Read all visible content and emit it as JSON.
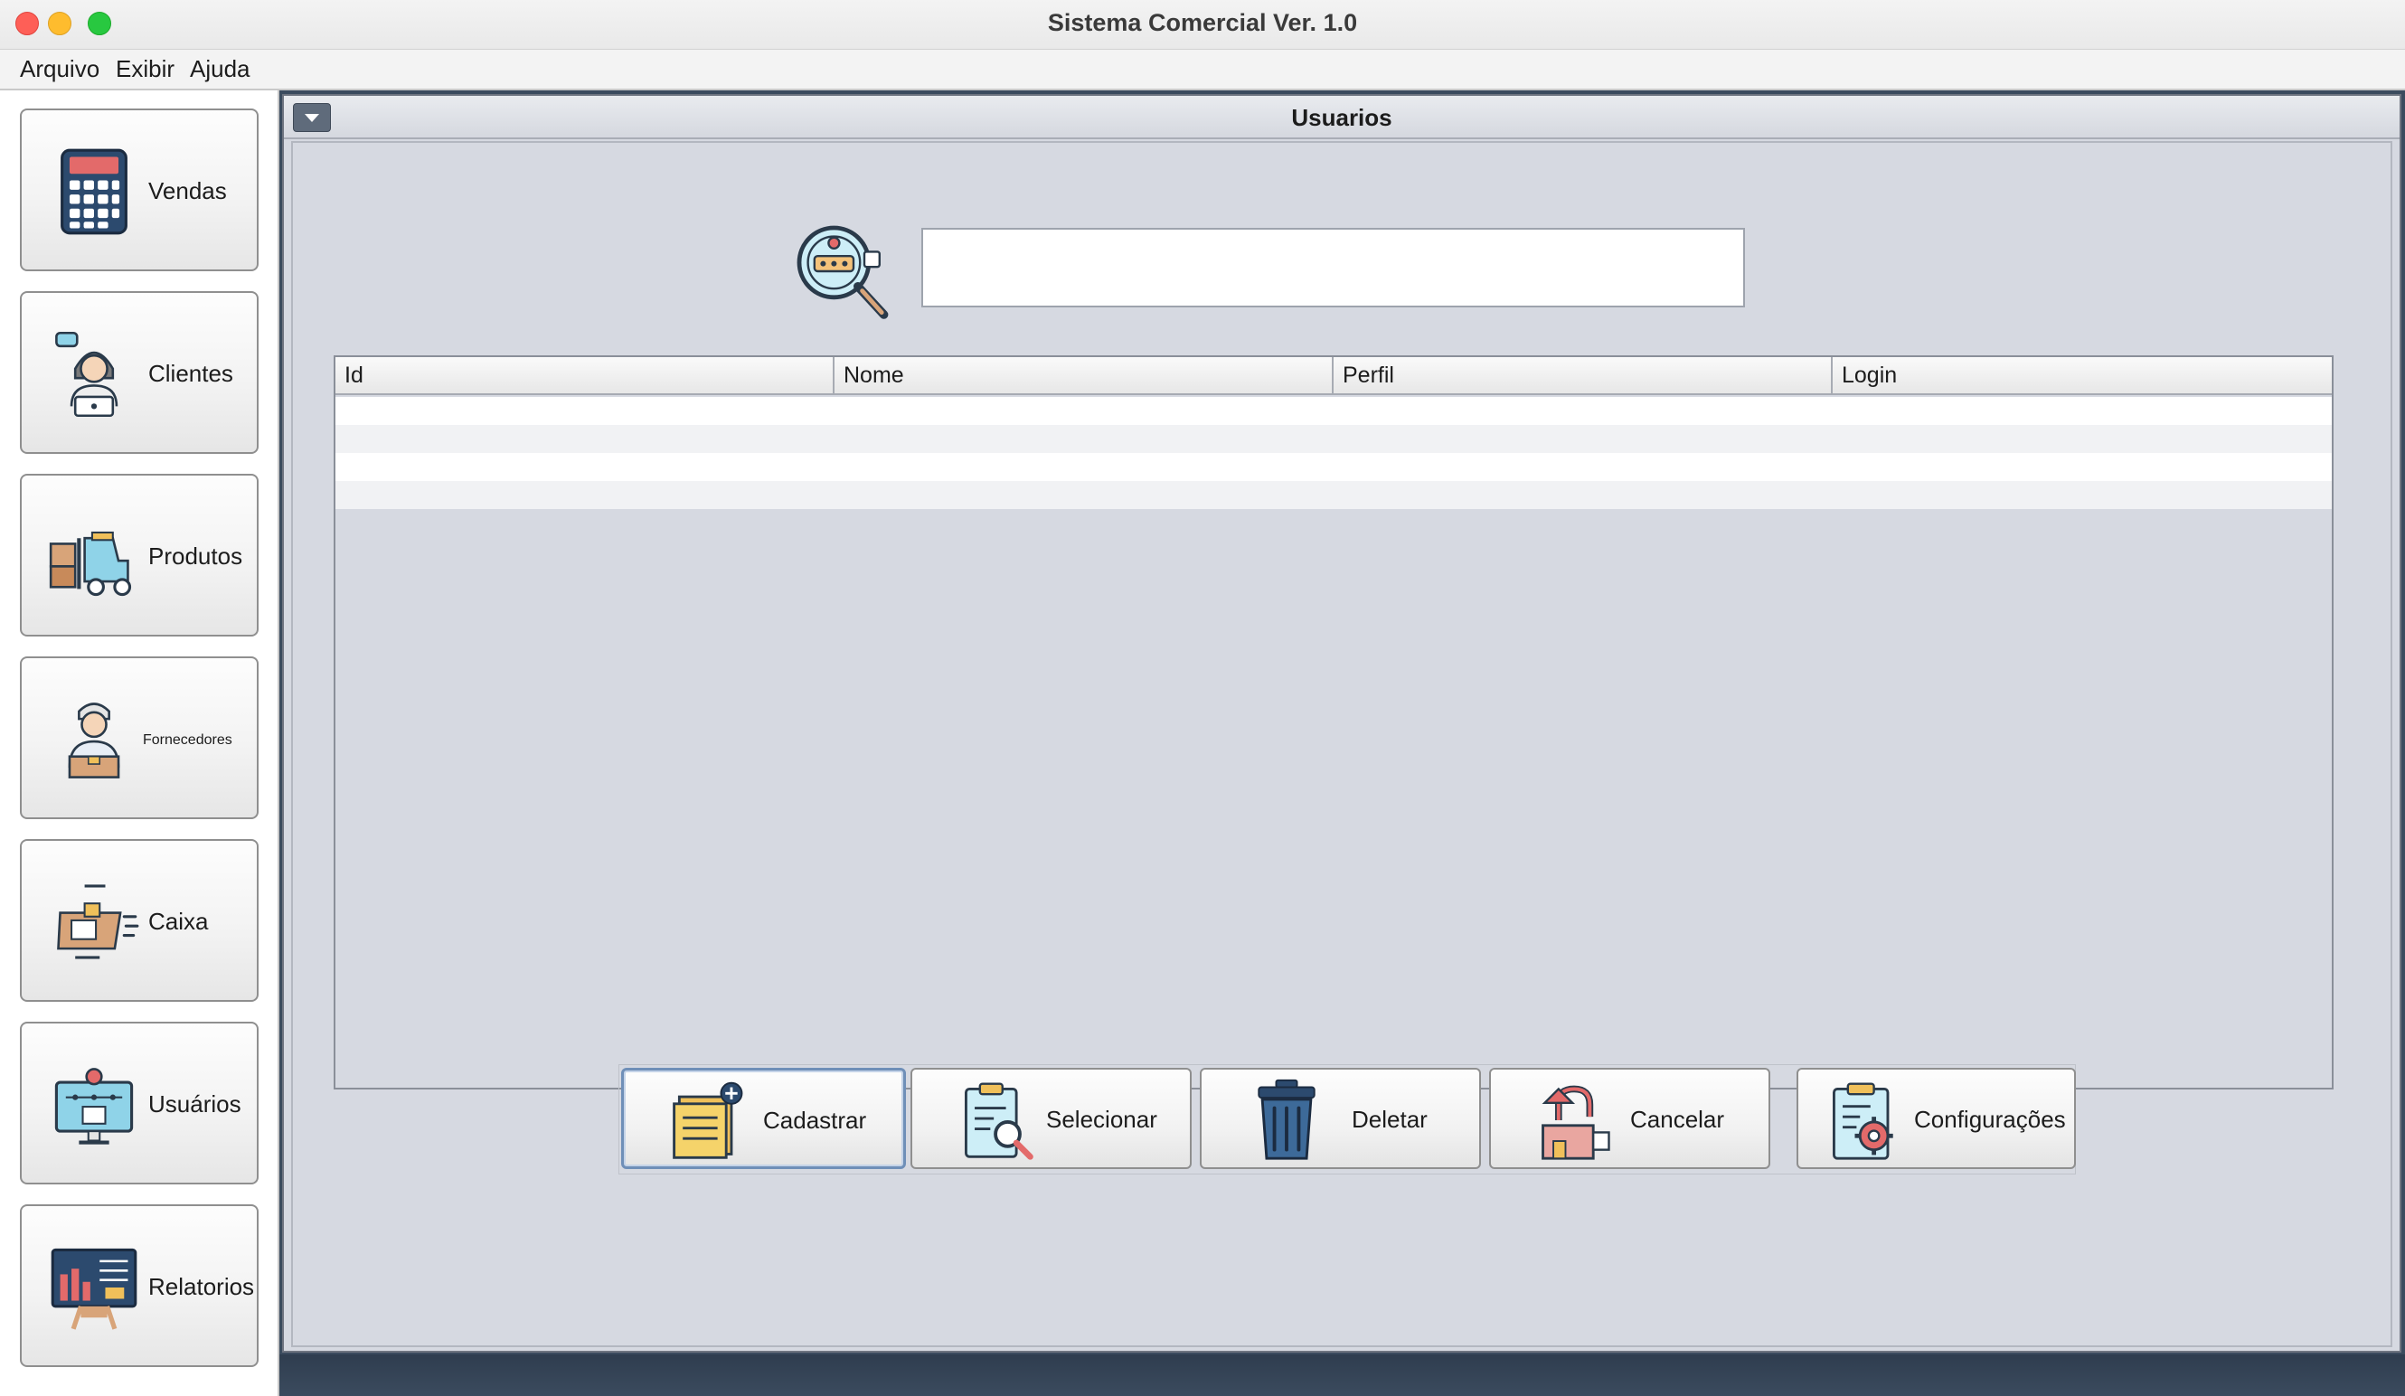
{
  "window": {
    "title": "Sistema Comercial Ver. 1.0"
  },
  "menubar": {
    "items": [
      "Arquivo",
      "Exibir",
      "Ajuda"
    ]
  },
  "sidebar": {
    "items": [
      {
        "label": "Vendas",
        "icon": "calculator-icon"
      },
      {
        "label": "Clientes",
        "icon": "customer-support-icon"
      },
      {
        "label": "Produtos",
        "icon": "forklift-icon"
      },
      {
        "label": "Fornecedores",
        "icon": "delivery-man-icon"
      },
      {
        "label": "Caixa",
        "icon": "cash-register-icon"
      },
      {
        "label": "Usuários",
        "icon": "user-monitor-icon"
      },
      {
        "label": "Relatorios",
        "icon": "presentation-chart-icon"
      }
    ]
  },
  "internal_frame": {
    "title": "Usuarios",
    "search": {
      "value": "",
      "placeholder": "",
      "icon": "search-magnifier-icon"
    },
    "table": {
      "columns": [
        "Id",
        "Nome",
        "Perfil",
        "Login"
      ],
      "rows": []
    },
    "actions": [
      {
        "label": "Cadastrar",
        "icon": "add-note-icon",
        "focused": true
      },
      {
        "label": "Selecionar",
        "icon": "clipboard-search-icon"
      },
      {
        "label": "Deletar",
        "icon": "trash-can-icon"
      },
      {
        "label": "Cancelar",
        "icon": "return-box-icon"
      },
      {
        "label": "Configurações",
        "icon": "clipboard-gear-icon"
      }
    ]
  }
}
